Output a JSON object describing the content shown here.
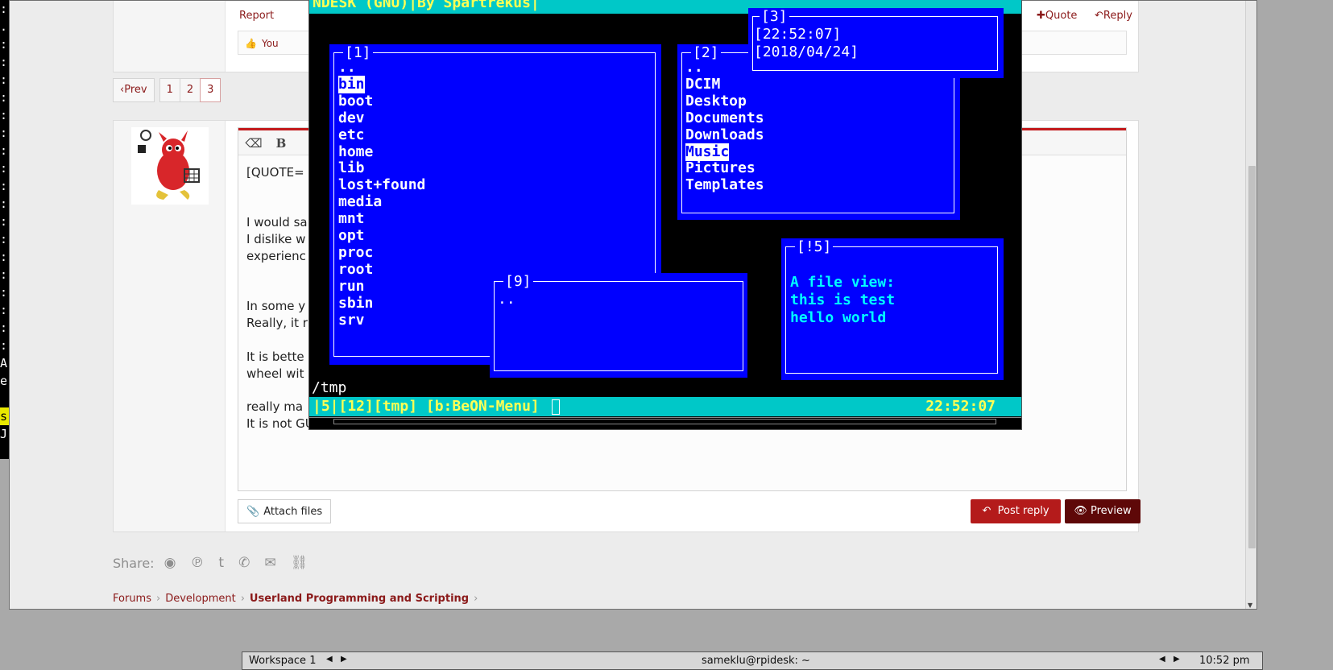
{
  "left_strip": {
    "chars": [
      ":",
      ".",
      ":",
      ":",
      ":",
      ":",
      ":",
      ":",
      ":",
      ":",
      ":",
      ":",
      ":",
      ":",
      ":",
      ":",
      ":",
      ":",
      ":",
      ":",
      "A",
      "e",
      "",
      "s",
      "J"
    ]
  },
  "post_top": {
    "report": "Report",
    "quote": "Quote",
    "reply": "Reply",
    "like_text": "You"
  },
  "pager": {
    "prev": "Prev",
    "pages": [
      "1",
      "2",
      "3"
    ],
    "current": "3"
  },
  "editor": {
    "lines": [
      "[QUOTE=",
      "",
      "",
      "I would sa",
      "I dislike w                                                                                                                                              ning the GUI",
      "experienc",
      "",
      "",
      "In some y                                                                                                                                               applications.",
      "Really, it r",
      "",
      "It is bette                                                                                                                                                 remake the",
      "wheel wit",
      "",
      "really ma",
      "It is not GUI but CLI, still beautiful..."
    ]
  },
  "buttons": {
    "attach": "Attach files",
    "post_reply": "Post reply",
    "preview": "Preview"
  },
  "share": {
    "label": "Share:"
  },
  "breadcrumbs": {
    "items": [
      "Forums",
      "Development",
      "Userland Programming and Scripting"
    ]
  },
  "terminal": {
    "title": "NDESK (GNU)|By Spartrekus|",
    "panel1": {
      "title": "[1]",
      "entries": [
        "..",
        "bin",
        "boot",
        "dev",
        "etc",
        "home",
        "lib",
        "lost+found",
        "media",
        "mnt",
        "opt",
        "proc",
        "root",
        "run",
        "sbin",
        "srv"
      ],
      "selected": "bin"
    },
    "panel2": {
      "title": "[2]",
      "entries": [
        "..",
        "DCIM",
        "Desktop",
        "Documents",
        "Downloads",
        "Music",
        "Pictures",
        "Templates"
      ],
      "selected": "Music"
    },
    "panel3": {
      "title": "[3]",
      "time": "[22:52:07]",
      "date": "[2018/04/24]"
    },
    "panel9": {
      "title": "[9]",
      "entries": [
        ".."
      ]
    },
    "panel5": {
      "title": "[!5]",
      "lines": [
        "A file view:",
        "this is test",
        "hello world"
      ]
    },
    "path": "/tmp",
    "status_left": "|5|[12][tmp]  [b:BeON-Menu]",
    "status_time": "22:52:07"
  },
  "taskbar": {
    "workspace": "Workspace 1",
    "window_title": "sameklu@rpidesk: ~",
    "clock": "10:52 pm"
  },
  "colors": {
    "accent": "#b41b1b",
    "dark_accent": "#5e0808",
    "term_panel": "#0000ff",
    "term_bar": "#00c8c8",
    "term_bar_text": "#ffff54"
  }
}
